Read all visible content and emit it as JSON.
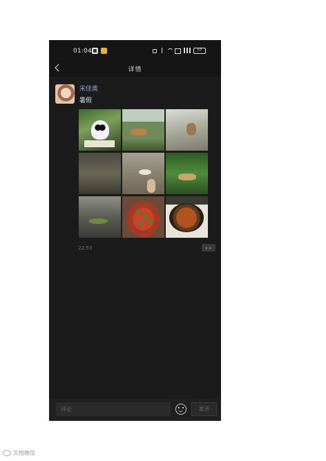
{
  "status_bar": {
    "time": "01:04",
    "battery": "57"
  },
  "nav": {
    "title": "详情"
  },
  "post": {
    "author": "宋佳奥",
    "text": "暑假",
    "time": "22:53",
    "photos": [
      {
        "icon": "panda-photo"
      },
      {
        "icon": "tiger-photo"
      },
      {
        "icon": "monkey-photo"
      },
      {
        "icon": "enclosure-photo"
      },
      {
        "icon": "bird-photo"
      },
      {
        "icon": "leopard-photo"
      },
      {
        "icon": "lizard-photo"
      },
      {
        "icon": "spicy-fish-photo"
      },
      {
        "icon": "stew-photo"
      }
    ]
  },
  "comment": {
    "placeholder": "评论",
    "send_label": "发送"
  },
  "watermark": {
    "text": "文档微信"
  },
  "colors": {
    "background": "#1b1b1b",
    "username": "#8ea3c4",
    "page": "#ffffff"
  }
}
